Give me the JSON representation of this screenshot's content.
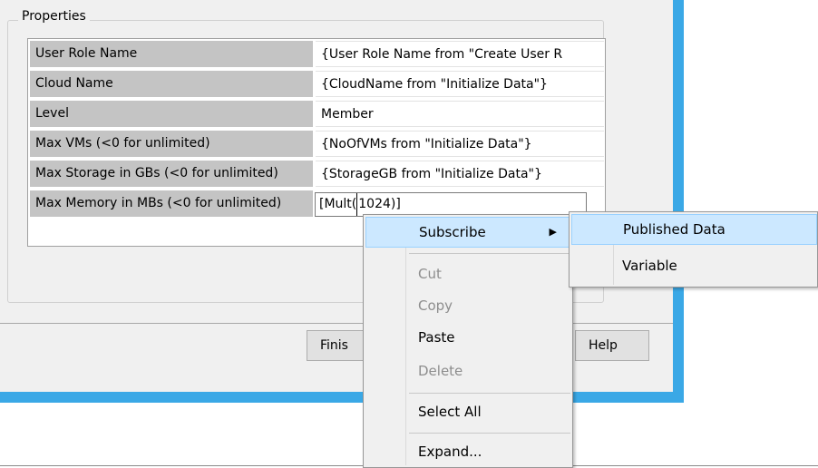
{
  "group": {
    "title": "Properties"
  },
  "properties": [
    {
      "label": "User Role Name",
      "value": "{User Role Name from \"Create User R"
    },
    {
      "label": "Cloud Name",
      "value": "{CloudName from \"Initialize Data\"}"
    },
    {
      "label": "Level",
      "value": "Member"
    },
    {
      "label": "Max VMs (<0 for unlimited)",
      "value": "{NoOfVMs from \"Initialize Data\"}"
    },
    {
      "label": "Max Storage in GBs (<0 for unlimited)",
      "value": "{StorageGB from \"Initialize Data\"}"
    },
    {
      "label": "Max Memory in MBs (<0 for unlimited)",
      "value_prefix": "[Mult(",
      "value_suffix": "1024)]"
    }
  ],
  "buttons": {
    "finish": "Finis",
    "help": "Help"
  },
  "context_menu": {
    "subscribe": "Subscribe",
    "submenu_arrow": "▶",
    "cut": "Cut",
    "copy": "Copy",
    "paste": "Paste",
    "delete": "Delete",
    "select_all": "Select All",
    "expand": "Expand..."
  },
  "submenu": {
    "published_data": "Published Data",
    "variable": "Variable"
  },
  "colors": {
    "window_border": "#3aa8e6",
    "highlight": "#cce8ff",
    "label_cell": "#c4c4c4"
  }
}
